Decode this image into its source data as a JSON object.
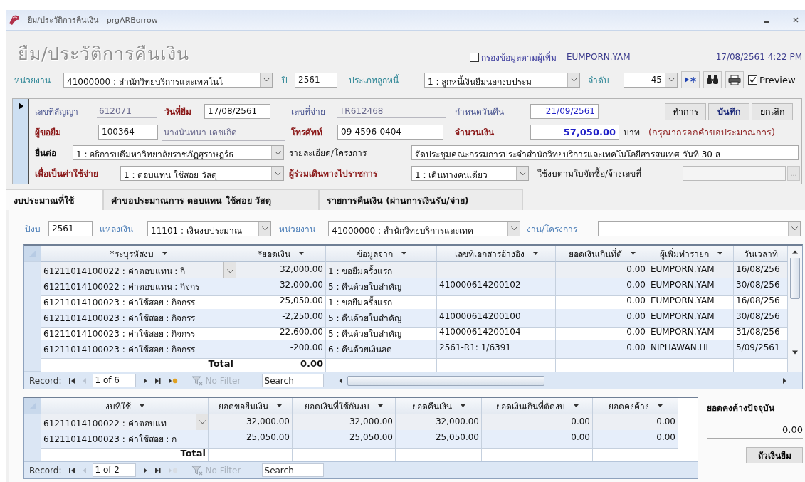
{
  "window": {
    "title": "ยืม/ประวัติการคืนเงิน - prgARBorrow"
  },
  "header": {
    "heading": "ยืม/ประวัติการคืนเงิน",
    "filter": {
      "label": "กรองข้อมูลตามผู้เพิ่ม",
      "checked": false
    },
    "user": "EUMPORN.YAM",
    "datetime": "17/08/2561 4:22 PM"
  },
  "toolbar": {
    "items": [
      {
        "kind": "label",
        "text": "หน่วยงาน"
      },
      {
        "kind": "combo",
        "value": "41000000 : สำนักวิทยบริการและเทคโนโ"
      },
      {
        "kind": "label",
        "text": "ปี"
      },
      {
        "kind": "text",
        "value": "2561"
      },
      {
        "kind": "label",
        "text": "ประเภทลูกหนี้"
      },
      {
        "kind": "combo",
        "value": "1 : ลูกหนี้เงินยืมนอกงบประม"
      },
      {
        "kind": "label",
        "text": "ลำดับ"
      },
      {
        "kind": "number-combo",
        "value": "45"
      }
    ],
    "preview": {
      "label": "Preview",
      "checked": true
    }
  },
  "record": {
    "lines": [
      [
        {
          "kind": "label",
          "text": "เลขที่สัญญา",
          "required": false,
          "locked": true
        },
        {
          "kind": "display",
          "value": "612071"
        },
        {
          "kind": "label",
          "text": "วันที่ยืม",
          "required": true,
          "locked": false
        },
        {
          "kind": "text",
          "value": "17/08/2561"
        },
        {
          "kind": "label",
          "text": "เลขที่จ่าย",
          "required": false,
          "locked": true
        },
        {
          "kind": "display",
          "value": "TR612468"
        },
        {
          "kind": "label",
          "text": "กำหนดวันคืน",
          "required": false,
          "locked": true
        },
        {
          "kind": "date",
          "value": "21/09/2561"
        }
      ],
      [
        {
          "kind": "label",
          "text": "ผู้ขอยืม",
          "required": true,
          "locked": false
        },
        {
          "kind": "text",
          "value": "100364"
        },
        {
          "kind": "display",
          "value": "นางนันทนา เดชเกิด"
        },
        {
          "kind": "label",
          "text": "โทรศัพท์",
          "required": true,
          "locked": false
        },
        {
          "kind": "text",
          "value": "09-4596-0404"
        },
        {
          "kind": "label",
          "text": "จำนวนเงิน",
          "required": true,
          "locked": false
        },
        {
          "kind": "amount",
          "value": "57,050.00"
        },
        {
          "kind": "label",
          "text": "บาท",
          "required": false,
          "locked": false
        },
        {
          "kind": "note",
          "text": "(กรุณากรอกคำขอประมาณการ)"
        }
      ],
      [
        {
          "kind": "label",
          "text": "ยื่นต่อ",
          "required": false,
          "locked": false
        },
        {
          "kind": "combo",
          "value": "1 : อธิการบดีมหาวิทยาลัยราชภัฏสุราษฎร์ธ"
        },
        {
          "kind": "label",
          "text": "รายละเอียด/โครงการ",
          "required": false,
          "locked": false
        },
        {
          "kind": "text",
          "value": "จัดประชุมคณะกรรมการประจำสำนักวิทยบริการและเทคโนโลยีสารสนเทศ วันที่ 30 ส"
        }
      ],
      [
        {
          "kind": "label",
          "text": "เพื่อเป็นค่าใช้จ่าย",
          "required": true,
          "locked": false
        },
        {
          "kind": "combo",
          "value": "1 : ตอบแทน ใช้สอย วัสดุ"
        },
        {
          "kind": "label",
          "text": "ผู้ร่วมเดินทางไปราชการ",
          "required": true,
          "locked": false
        },
        {
          "kind": "combo",
          "value": "1 : เดินทางคนเดียว"
        },
        {
          "kind": "label",
          "text": "ใช้งบตามใบจัดซื้อ/จ้างเลขที่",
          "required": false,
          "locked": false
        },
        {
          "kind": "lookup",
          "button_label": "..."
        }
      ]
    ],
    "buttons": [
      {
        "label": "ทำการ",
        "default": false
      },
      {
        "label": "บันทึก",
        "default": true
      },
      {
        "label": "ยกเลิก",
        "default": false
      }
    ]
  },
  "tabs": [
    {
      "label": "งบประมาณที่ใช้",
      "selected": true
    },
    {
      "label": "คำขอประมาณการ ตอบแทน ใช้สอย วัสดุ",
      "selected": false
    },
    {
      "label": "รายการคืนเงิน (ผ่านการเงินรับ/จ่าย)",
      "selected": false
    }
  ],
  "budget_filter": {
    "items": [
      {
        "kind": "label",
        "text": "ปีงบ"
      },
      {
        "kind": "text",
        "value": "2561"
      },
      {
        "kind": "label",
        "text": "แหล่งเงิน"
      },
      {
        "kind": "combo",
        "value": "11101 : เงินงบประมาณ"
      },
      {
        "kind": "label",
        "text": "หน่วยงาน"
      },
      {
        "kind": "combo",
        "value": "41000000 : สำนักวิทยบริการและเทค"
      },
      {
        "kind": "label",
        "text": "งาน/โครงการ"
      },
      {
        "kind": "combo"
      }
    ]
  },
  "budget_grid": {
    "columns": [
      {
        "label": "*ระบุรหัสงบ",
        "kind": "text"
      },
      {
        "label": "*ยอดเงิน",
        "kind": "number"
      },
      {
        "label": "ข้อมูลจาก",
        "kind": "text"
      },
      {
        "label": "เลขที่เอกสารอ้างอิง",
        "kind": "text"
      },
      {
        "label": "ยอดเงินเกินที่ตั",
        "kind": "number"
      },
      {
        "label": "ผู้เพิ่มทำรายก",
        "kind": "text"
      },
      {
        "label": "วันเวลาที่",
        "kind": "text"
      }
    ],
    "rows": [
      {
        "selected": true,
        "cells": [
          "61211014100022 : ค่าตอบแทน : กิ",
          "32,000.00",
          "1 : ขอยืมครั้งแรก",
          null,
          "0.00",
          "EUMPORN.YAM",
          "16/08/256"
        ]
      },
      {
        "selected": false,
        "cells": [
          "61211014100022 : ค่าตอบแทน : กิจกร",
          "-32,000.00",
          "5 : คืนด้วยใบสำคัญ",
          "410000614200102",
          "0.00",
          "EUMPORN.YAM",
          "30/08/256"
        ]
      },
      {
        "selected": false,
        "cells": [
          "61211014100023 : ค่าใช้สอย : กิจกรร",
          "25,050.00",
          "1 : ขอยืมครั้งแรก",
          null,
          "0.00",
          "EUMPORN.YAM",
          "16/08/256"
        ]
      },
      {
        "selected": false,
        "cells": [
          "61211014100023 : ค่าใช้สอย : กิจกรร",
          "-2,250.00",
          "5 : คืนด้วยใบสำคัญ",
          "410000614200100",
          "0.00",
          "EUMPORN.YAM",
          "30/08/256"
        ]
      },
      {
        "selected": false,
        "cells": [
          "61211014100023 : ค่าใช้สอย : กิจกรร",
          "-22,600.00",
          "5 : คืนด้วยใบสำคัญ",
          "410000614200104",
          "0.00",
          "EUMPORN.YAM",
          "31/08/256"
        ]
      },
      {
        "selected": false,
        "cells": [
          "61211014100023 : ค่าใช้สอย : กิจกรร",
          "-200.00",
          "6 : คืนด้วยเงินสด",
          "2561-R1: 1/6391",
          "0.00",
          "NIPHAWAN.HI",
          "5/09/2561"
        ]
      }
    ],
    "total": {
      "label": "Total",
      "values": [
        "0.00"
      ]
    },
    "nav": {
      "record_label": "Record:",
      "position": "1 of 6",
      "can_add": true,
      "filter_label": "No Filter",
      "search_placeholder": "Search"
    }
  },
  "summary_grid": {
    "columns": [
      {
        "label": "งบที่ใช้",
        "kind": "text"
      },
      {
        "label": "ยอดขอยืมเงิน",
        "kind": "number"
      },
      {
        "label": "ยอดเงินที่ใช้กันงบ",
        "kind": "number"
      },
      {
        "label": "ยอดคืนเงิน",
        "kind": "number"
      },
      {
        "label": "ยอดเงินเกินที่ตัดงบ",
        "kind": "number"
      },
      {
        "label": "ยอดคงค้าง",
        "kind": "number"
      }
    ],
    "rows": [
      {
        "selected": true,
        "cells": [
          "61211014100022 : ค่าตอบแท",
          "32,000.00",
          "32,000.00",
          "32,000.00",
          "0.00",
          "0.00"
        ]
      },
      {
        "selected": false,
        "cells": [
          "61211014100023 : ค่าใช้สอย : ก",
          "25,050.00",
          "25,050.00",
          "25,050.00",
          "0.00",
          "0.00"
        ]
      }
    ],
    "total": {
      "label": "Total"
    },
    "nav": {
      "record_label": "Record:",
      "position": "1 of 2",
      "can_add": false,
      "filter_label": "No Filter",
      "search_placeholder": "Search"
    }
  },
  "balance": {
    "label": "ยอดคงค้างปัจจุบัน",
    "value": "0.00",
    "button": "ถัวเงินยืม"
  }
}
